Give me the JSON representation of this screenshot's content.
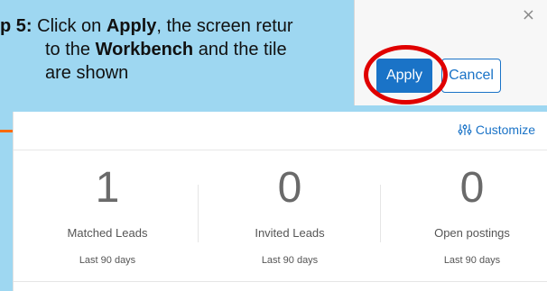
{
  "instruction": {
    "prefix_bold": "p 5:",
    "line1_a": " Click on ",
    "line1_bold": "Apply",
    "line1_b": ", the screen retur",
    "line2_a": "to the ",
    "line2_bold": "Workbench",
    "line2_b": " and the tile",
    "line3": "are shown"
  },
  "dialog": {
    "close_glyph": "×",
    "apply_label": "Apply",
    "cancel_label": "Cancel"
  },
  "workbench": {
    "customize_label": "Customize",
    "tiles": [
      {
        "value": "1",
        "label": "Matched Leads",
        "period": "Last 90 days"
      },
      {
        "value": "0",
        "label": "Invited Leads",
        "period": "Last 90 days"
      },
      {
        "value": "0",
        "label": "Open postings",
        "period": "Last 90 days"
      }
    ]
  },
  "colors": {
    "background": "#9ed7f1",
    "accent_blue": "#1a73c7",
    "highlight_red": "#e00000",
    "accent_orange": "#ff6a00"
  },
  "icons": {
    "customize": "sliders-icon",
    "close": "close-icon"
  }
}
